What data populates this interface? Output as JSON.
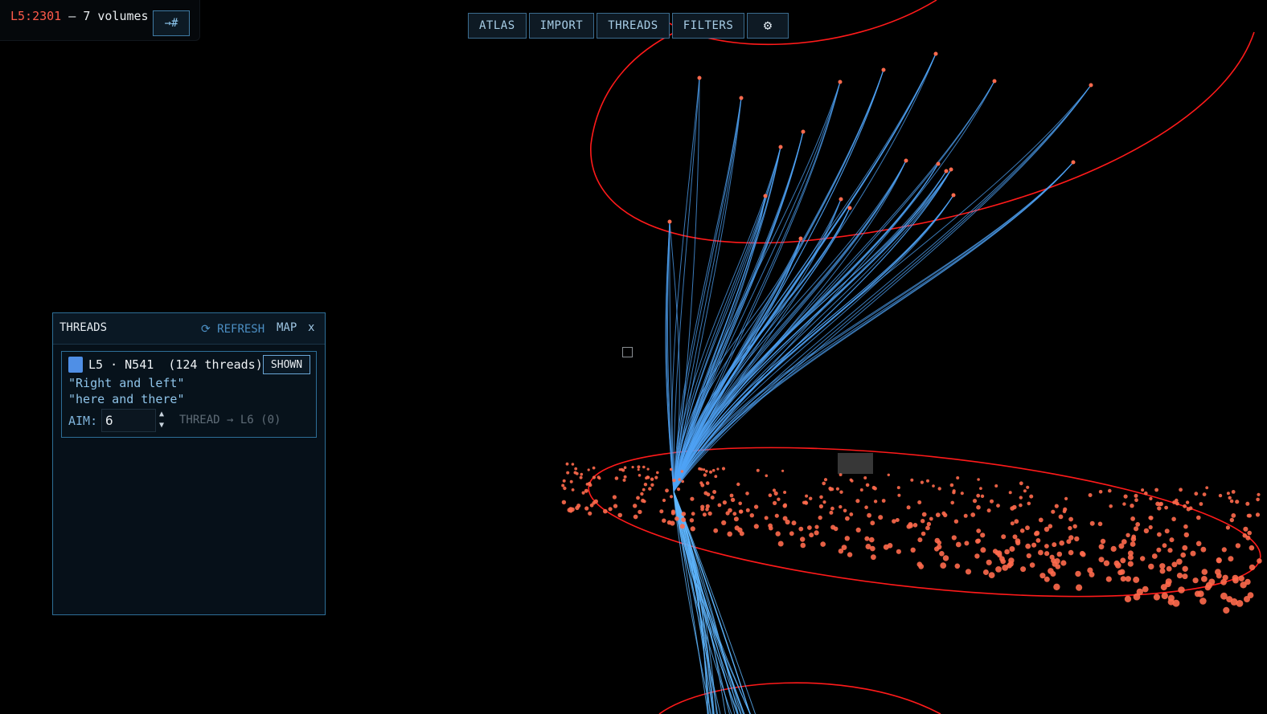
{
  "status": {
    "location": "L5:2301",
    "separator": " — ",
    "volumes": "7 volumes",
    "jump_label": "→#"
  },
  "nav": {
    "atlas": "ATLAS",
    "import": "IMPORT",
    "threads": "THREADS",
    "filters": "FILTERS",
    "settings_icon": "⚙"
  },
  "panel": {
    "title": "THREADS",
    "refresh": "⟳ REFRESH",
    "map": "MAP",
    "close": "x",
    "card": {
      "swatch_color": "#4f8fe6",
      "title": "L5 · N541  (124 threads)",
      "shown": "SHOWN",
      "quote1": "\"Right and left\"",
      "quote2": "\"here and there\"",
      "aim_label": "AIM:",
      "aim_value": "6",
      "thread_to": "THREAD → L6 (0)"
    }
  },
  "scene": {
    "thread_color": "#4fa3f5",
    "ring_color": "#ff1a1a",
    "node_color": "#ff6a4d"
  }
}
